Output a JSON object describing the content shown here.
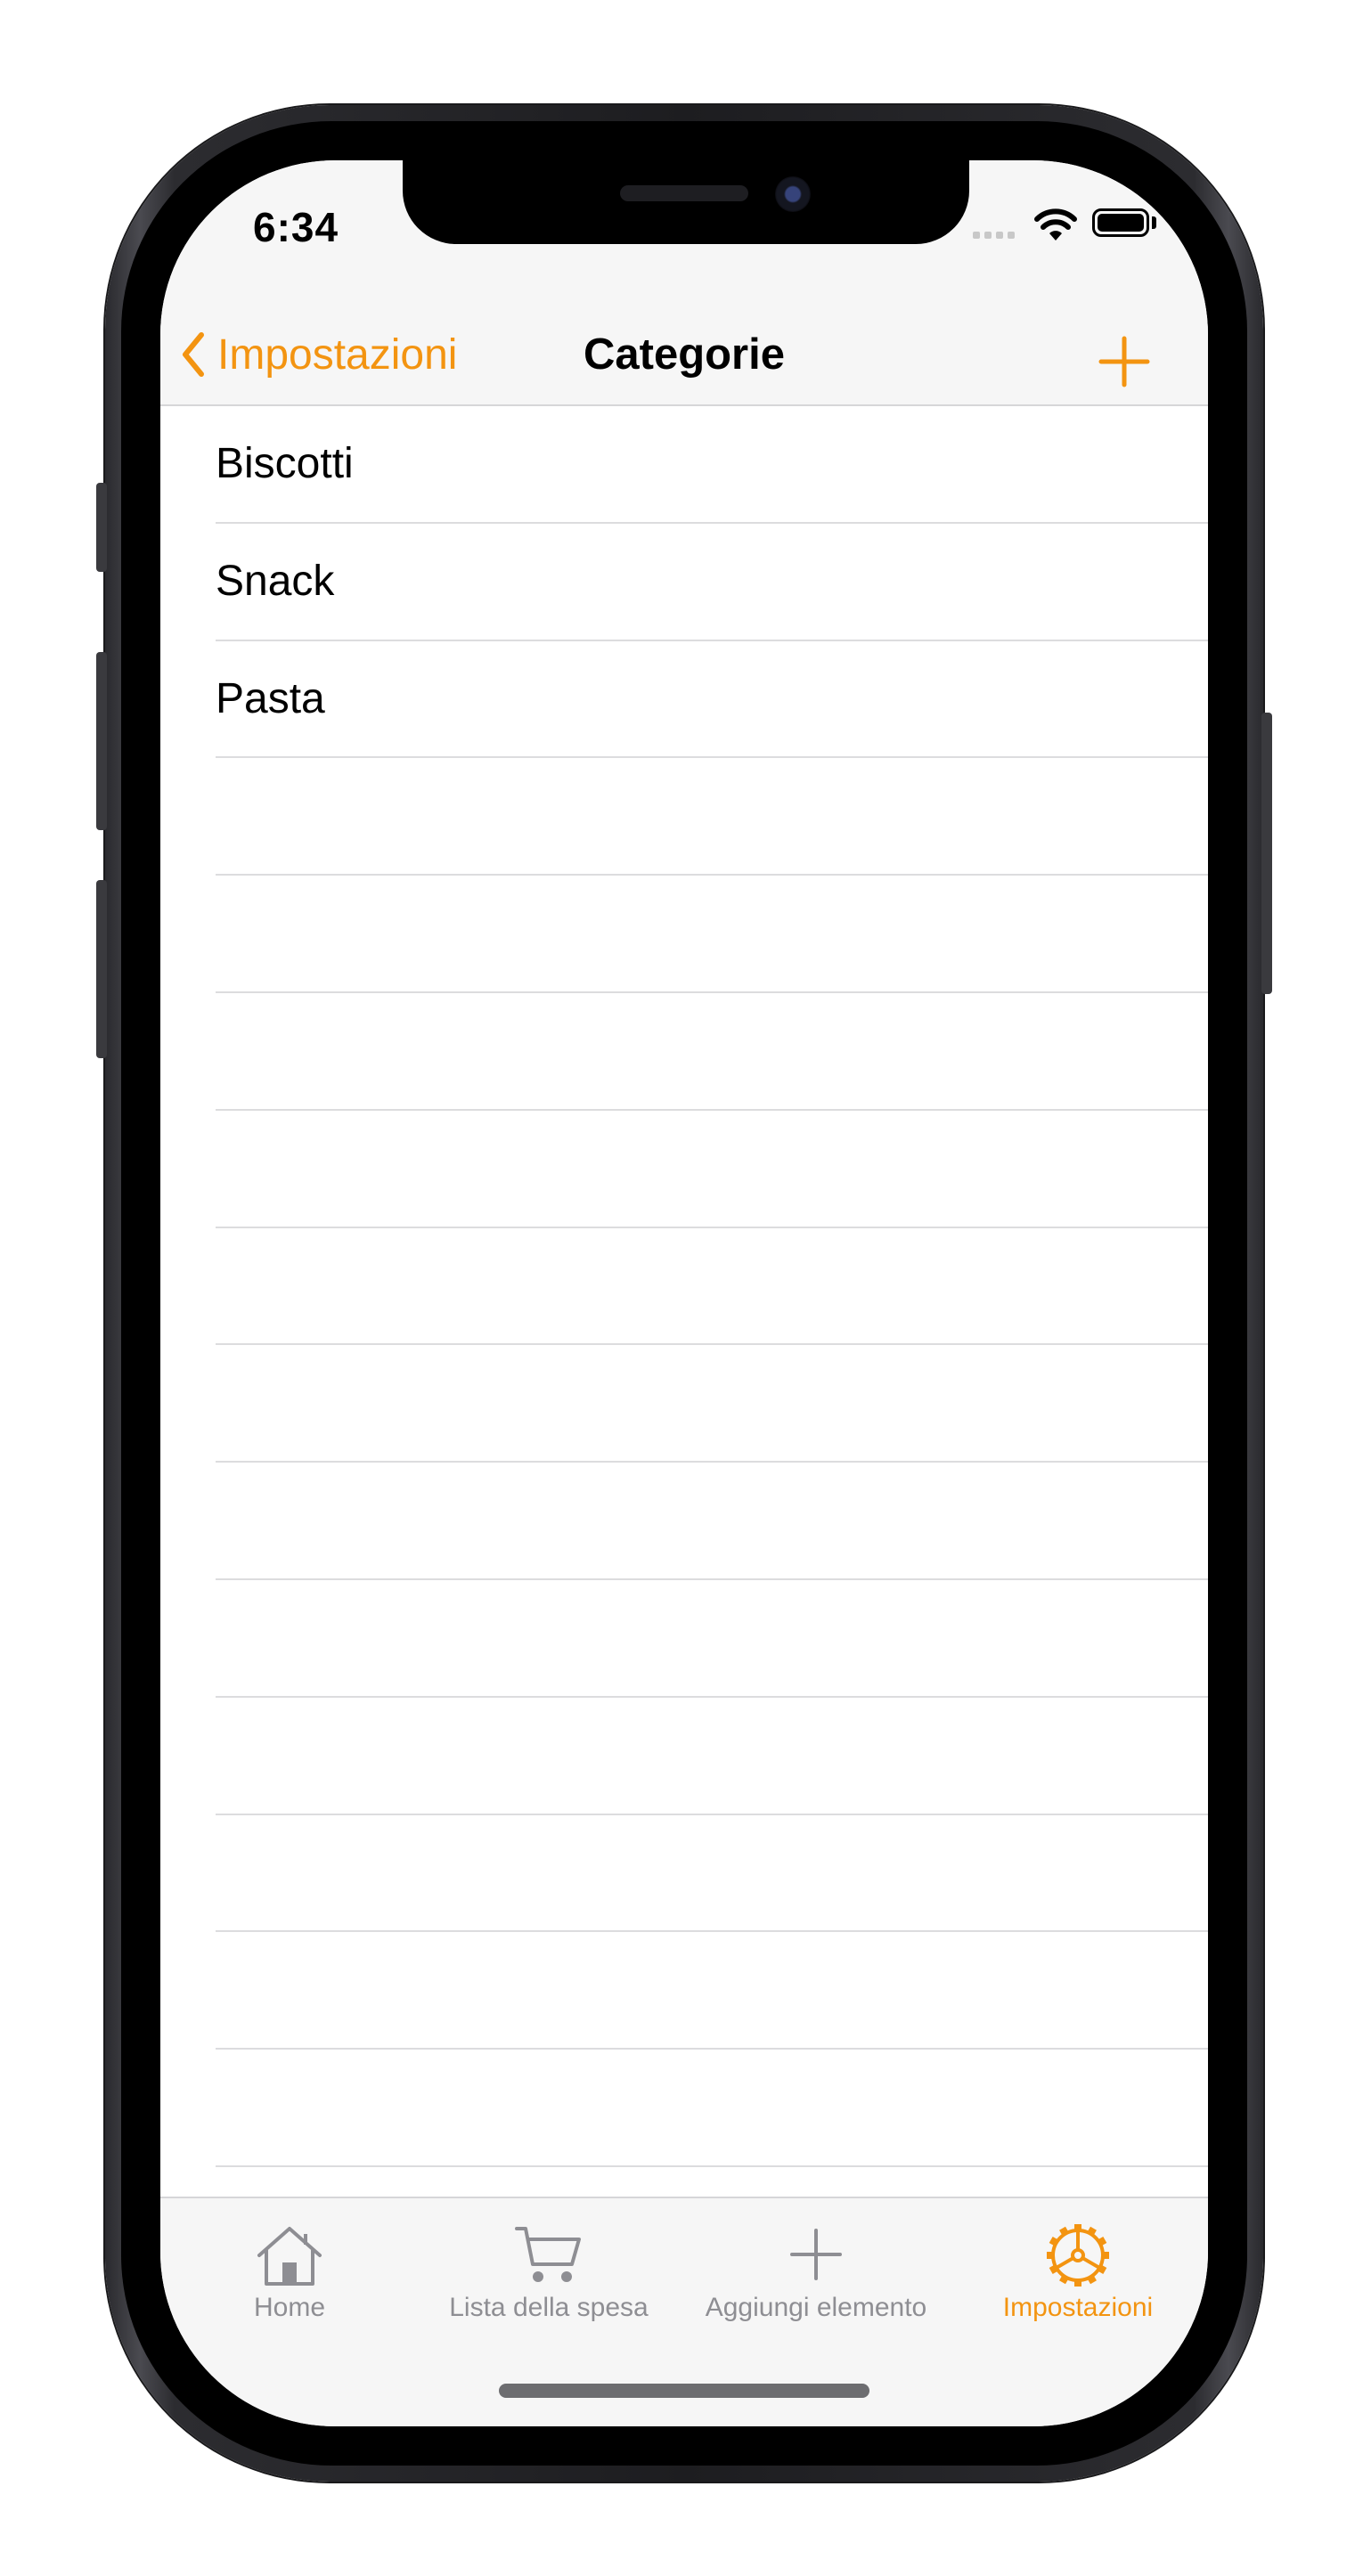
{
  "status_bar": {
    "time": "6:34"
  },
  "nav": {
    "back_label": "Impostazioni",
    "title": "Categorie"
  },
  "categories": [
    {
      "label": "Biscotti"
    },
    {
      "label": "Snack"
    },
    {
      "label": "Pasta"
    },
    {
      "label": ""
    },
    {
      "label": ""
    },
    {
      "label": ""
    },
    {
      "label": ""
    },
    {
      "label": ""
    },
    {
      "label": ""
    },
    {
      "label": ""
    },
    {
      "label": ""
    },
    {
      "label": ""
    },
    {
      "label": ""
    },
    {
      "label": ""
    },
    {
      "label": ""
    }
  ],
  "tabs": [
    {
      "label": "Home",
      "icon": "house-icon",
      "active": false
    },
    {
      "label": "Lista della spesa",
      "icon": "cart-icon",
      "active": false
    },
    {
      "label": "Aggiungi elemento",
      "icon": "plus-icon",
      "active": false
    },
    {
      "label": "Impostazioni",
      "icon": "gear-icon",
      "active": true
    }
  ],
  "colors": {
    "accent": "#f39411",
    "inactive": "#8e8e93",
    "bar_background": "#f6f6f6"
  }
}
